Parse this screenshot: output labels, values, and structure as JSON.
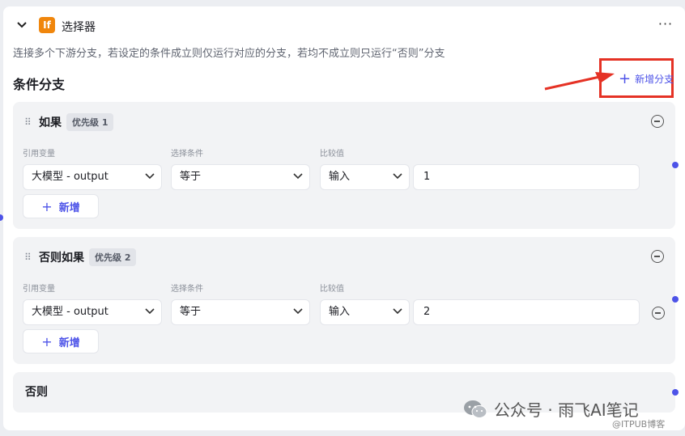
{
  "header": {
    "node_icon_text": "If",
    "title": "选择器",
    "more_label": "···"
  },
  "description": "连接多个下游分支，若设定的条件成立则仅运行对应的分支，若均不成立则只运行“否则”分支",
  "section_title": "条件分支",
  "add_branch_label": "新增分支",
  "column_labels": {
    "variable": "引用变量",
    "condition": "选择条件",
    "compare": "比较值"
  },
  "branches": [
    {
      "label": "如果",
      "priority": "优先级 1",
      "variable": "大模型 - output",
      "condition": "等于",
      "compare_type": "输入",
      "value": "1",
      "add_label": "新增"
    },
    {
      "label": "否则如果",
      "priority": "优先级 2",
      "variable": "大模型 - output",
      "condition": "等于",
      "compare_type": "输入",
      "value": "2",
      "add_label": "新增"
    }
  ],
  "else_label": "否则",
  "watermark": {
    "main": "公众号 · 雨飞AI笔记",
    "sub": "@ITPUB博客"
  },
  "colors": {
    "accent": "#4d53e8",
    "node_icon": "#f0860c",
    "highlight": "#e53225"
  }
}
